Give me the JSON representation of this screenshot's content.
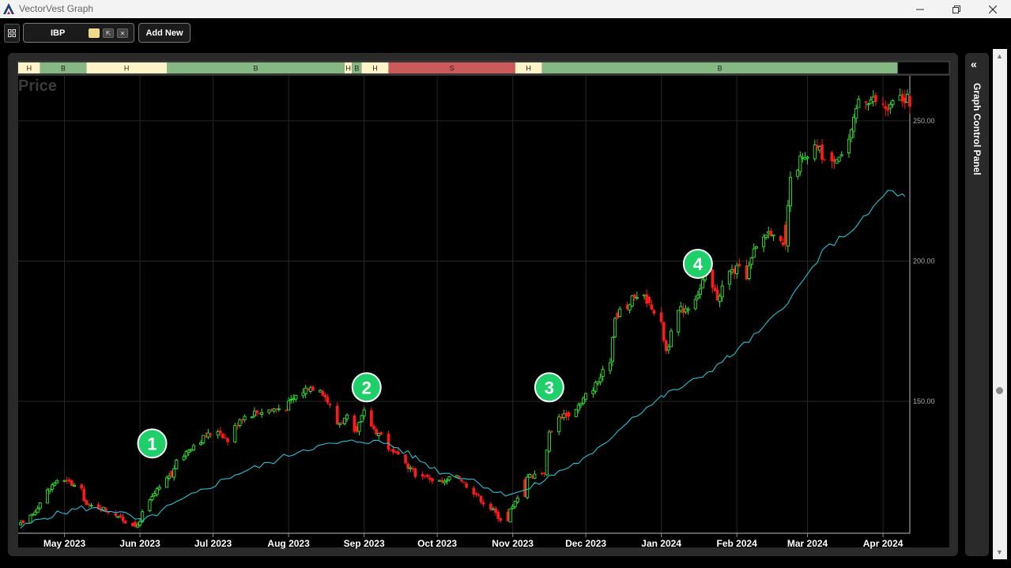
{
  "window": {
    "title": "VectorVest Graph",
    "minimize_icon": "minimize-icon",
    "restore_icon": "restore-icon",
    "close_icon": "close-icon"
  },
  "toolbar": {
    "symbol": "IBP",
    "add_new_label": "Add New"
  },
  "side_panel": {
    "label": "Graph Control Panel",
    "collapse_icon": "double-chevron-left-icon"
  },
  "chart_data": {
    "type": "candlestick",
    "title": "Price",
    "xlabel": "",
    "ylabel": "",
    "ylim": [
      103,
      266
    ],
    "y_ticks": [
      150,
      200,
      250
    ],
    "y_tick_labels": [
      "150.00",
      "200.00",
      "250.00"
    ],
    "x_tick_labels": [
      "May 2023",
      "Jun 2023",
      "Jul 2023",
      "Aug 2023",
      "Sep 2023",
      "Oct 2023",
      "Nov 2023",
      "Dec 2023",
      "Jan 2024",
      "Feb 2024",
      "Mar 2024",
      "Apr 2024"
    ],
    "x_range": [
      "2023-04-12",
      "2024-04-12"
    ],
    "grid": true,
    "candle_colors": {
      "up": "#2ee82e",
      "down": "#ff1a1a"
    },
    "signal_bar": [
      {
        "label": "H",
        "start": "2023-04-12",
        "end": "2023-04-21",
        "color": "#fff4c8"
      },
      {
        "label": "B",
        "start": "2023-04-21",
        "end": "2023-05-10",
        "color": "#86b883"
      },
      {
        "label": "H",
        "start": "2023-05-10",
        "end": "2023-06-12",
        "color": "#fff4c8"
      },
      {
        "label": "B",
        "start": "2023-06-12",
        "end": "2023-08-24",
        "color": "#86b883"
      },
      {
        "label": "H",
        "start": "2023-08-24",
        "end": "2023-08-27",
        "color": "#fff4c8"
      },
      {
        "label": "B",
        "start": "2023-08-27",
        "end": "2023-08-31",
        "color": "#86b883"
      },
      {
        "label": "H",
        "start": "2023-08-31",
        "end": "2023-09-11",
        "color": "#fff4c8"
      },
      {
        "label": "S",
        "start": "2023-09-11",
        "end": "2023-11-02",
        "color": "#cc5a5a"
      },
      {
        "label": "H",
        "start": "2023-11-02",
        "end": "2023-11-13",
        "color": "#fff4c8"
      },
      {
        "label": "B",
        "start": "2023-11-13",
        "end": "2024-04-07",
        "color": "#86b883"
      }
    ],
    "price_path": [
      [
        "2023-04-13",
        106
      ],
      [
        "2023-04-18",
        110
      ],
      [
        "2023-04-24",
        118
      ],
      [
        "2023-04-28",
        122
      ],
      [
        "2023-05-03",
        121
      ],
      [
        "2023-05-08",
        118
      ],
      [
        "2023-05-10",
        113
      ],
      [
        "2023-05-16",
        112
      ],
      [
        "2023-05-22",
        110
      ],
      [
        "2023-05-26",
        107
      ],
      [
        "2023-05-31",
        106
      ],
      [
        "2023-06-02",
        110
      ],
      [
        "2023-06-07",
        117
      ],
      [
        "2023-06-12",
        122
      ],
      [
        "2023-06-16",
        128
      ],
      [
        "2023-06-22",
        134
      ],
      [
        "2023-06-27",
        137
      ],
      [
        "2023-07-03",
        140
      ],
      [
        "2023-07-07",
        136
      ],
      [
        "2023-07-12",
        144
      ],
      [
        "2023-07-18",
        146
      ],
      [
        "2023-07-24",
        147
      ],
      [
        "2023-07-31",
        148
      ],
      [
        "2023-08-04",
        152
      ],
      [
        "2023-08-09",
        155
      ],
      [
        "2023-08-14",
        155
      ],
      [
        "2023-08-17",
        150
      ],
      [
        "2023-08-21",
        142
      ],
      [
        "2023-08-25",
        144
      ],
      [
        "2023-08-28",
        138
      ],
      [
        "2023-09-01",
        146
      ],
      [
        "2023-09-05",
        140
      ],
      [
        "2023-09-08",
        138
      ],
      [
        "2023-09-12",
        132
      ],
      [
        "2023-09-15",
        130
      ],
      [
        "2023-09-19",
        127
      ],
      [
        "2023-09-22",
        124
      ],
      [
        "2023-09-26",
        124
      ],
      [
        "2023-09-29",
        122
      ],
      [
        "2023-10-04",
        121
      ],
      [
        "2023-10-09",
        124
      ],
      [
        "2023-10-12",
        121
      ],
      [
        "2023-10-17",
        117
      ],
      [
        "2023-10-20",
        114
      ],
      [
        "2023-10-24",
        111
      ],
      [
        "2023-10-27",
        108
      ],
      [
        "2023-11-01",
        112
      ],
      [
        "2023-11-06",
        123
      ],
      [
        "2023-11-10",
        124
      ],
      [
        "2023-11-14",
        125
      ],
      [
        "2023-11-16",
        139
      ],
      [
        "2023-11-21",
        145
      ],
      [
        "2023-11-24",
        146
      ],
      [
        "2023-11-29",
        149
      ],
      [
        "2023-12-01",
        152
      ],
      [
        "2023-12-05",
        156
      ],
      [
        "2023-12-08",
        160
      ],
      [
        "2023-12-11",
        165
      ],
      [
        "2023-12-13",
        181
      ],
      [
        "2023-12-18",
        184
      ],
      [
        "2023-12-22",
        188
      ],
      [
        "2023-12-27",
        186
      ],
      [
        "2024-01-01",
        177
      ],
      [
        "2024-01-03",
        168
      ],
      [
        "2024-01-08",
        182
      ],
      [
        "2024-01-12",
        184
      ],
      [
        "2024-01-17",
        190
      ],
      [
        "2024-01-19",
        195
      ],
      [
        "2024-01-24",
        187
      ],
      [
        "2024-01-29",
        196
      ],
      [
        "2024-02-01",
        197
      ],
      [
        "2024-02-05",
        195
      ],
      [
        "2024-02-08",
        203
      ],
      [
        "2024-02-13",
        210
      ],
      [
        "2024-02-16",
        211
      ],
      [
        "2024-02-20",
        204
      ],
      [
        "2024-02-23",
        228
      ],
      [
        "2024-02-27",
        236
      ],
      [
        "2024-03-01",
        236
      ],
      [
        "2024-03-05",
        241
      ],
      [
        "2024-03-08",
        236
      ],
      [
        "2024-03-12",
        238
      ],
      [
        "2024-03-15",
        238
      ],
      [
        "2024-03-19",
        245
      ],
      [
        "2024-03-22",
        258
      ],
      [
        "2024-03-26",
        258
      ],
      [
        "2024-03-29",
        257
      ],
      [
        "2024-04-03",
        254
      ],
      [
        "2024-04-08",
        258
      ],
      [
        "2024-04-12",
        257
      ]
    ],
    "forced_down_dates": [
      "2023-04-14",
      "2023-05-09",
      "2023-05-11",
      "2023-05-24",
      "2023-05-30",
      "2023-06-14",
      "2023-07-06",
      "2023-07-25",
      "2023-08-17",
      "2023-08-18",
      "2023-08-21",
      "2023-08-29",
      "2023-09-05",
      "2023-09-06",
      "2023-09-12",
      "2023-09-13",
      "2023-09-14",
      "2023-09-25",
      "2023-09-27",
      "2023-10-12",
      "2023-10-16",
      "2023-10-18",
      "2023-10-23",
      "2023-10-25",
      "2023-10-26",
      "2023-10-27",
      "2023-10-30",
      "2023-11-06",
      "2023-11-21",
      "2023-11-24",
      "2023-12-14",
      "2023-12-18",
      "2023-12-27",
      "2023-12-28",
      "2023-12-29",
      "2024-01-02",
      "2024-01-03",
      "2024-01-22",
      "2024-01-23",
      "2024-02-19",
      "2024-02-20",
      "2024-02-21",
      "2024-03-07",
      "2024-03-08",
      "2024-03-11",
      "2024-03-12",
      "2024-03-25",
      "2024-04-01",
      "2024-04-02",
      "2024-04-10",
      "2024-04-12"
    ],
    "ma_series": {
      "name": "",
      "color": "#1fc3d8",
      "points": [
        [
          "2023-04-13",
          105
        ],
        [
          "2023-04-24",
          109
        ],
        [
          "2023-05-08",
          112
        ],
        [
          "2023-05-22",
          111
        ],
        [
          "2023-06-02",
          107
        ],
        [
          "2023-06-12",
          112
        ],
        [
          "2023-06-26",
          118
        ],
        [
          "2023-07-10",
          124
        ],
        [
          "2023-07-24",
          128
        ],
        [
          "2023-08-07",
          133
        ],
        [
          "2023-08-21",
          135
        ],
        [
          "2023-09-01",
          136
        ],
        [
          "2023-09-11",
          135
        ],
        [
          "2023-09-22",
          130
        ],
        [
          "2023-10-02",
          125
        ],
        [
          "2023-10-16",
          122
        ],
        [
          "2023-10-27",
          117
        ],
        [
          "2023-11-06",
          118
        ],
        [
          "2023-11-20",
          125
        ],
        [
          "2023-12-04",
          131
        ],
        [
          "2023-12-18",
          143
        ],
        [
          "2024-01-02",
          152
        ],
        [
          "2024-01-16",
          158
        ],
        [
          "2024-01-29",
          166
        ],
        [
          "2024-02-12",
          176
        ],
        [
          "2024-02-26",
          190
        ],
        [
          "2024-03-08",
          204
        ],
        [
          "2024-03-22",
          213
        ],
        [
          "2024-04-03",
          225
        ],
        [
          "2024-04-10",
          223
        ]
      ]
    },
    "annotations": [
      {
        "label": "1",
        "date": "2023-06-06",
        "value": 135
      },
      {
        "label": "2",
        "date": "2023-09-02",
        "value": 155
      },
      {
        "label": "3",
        "date": "2023-11-16",
        "value": 155
      },
      {
        "label": "4",
        "date": "2024-01-16",
        "value": 199
      }
    ]
  }
}
